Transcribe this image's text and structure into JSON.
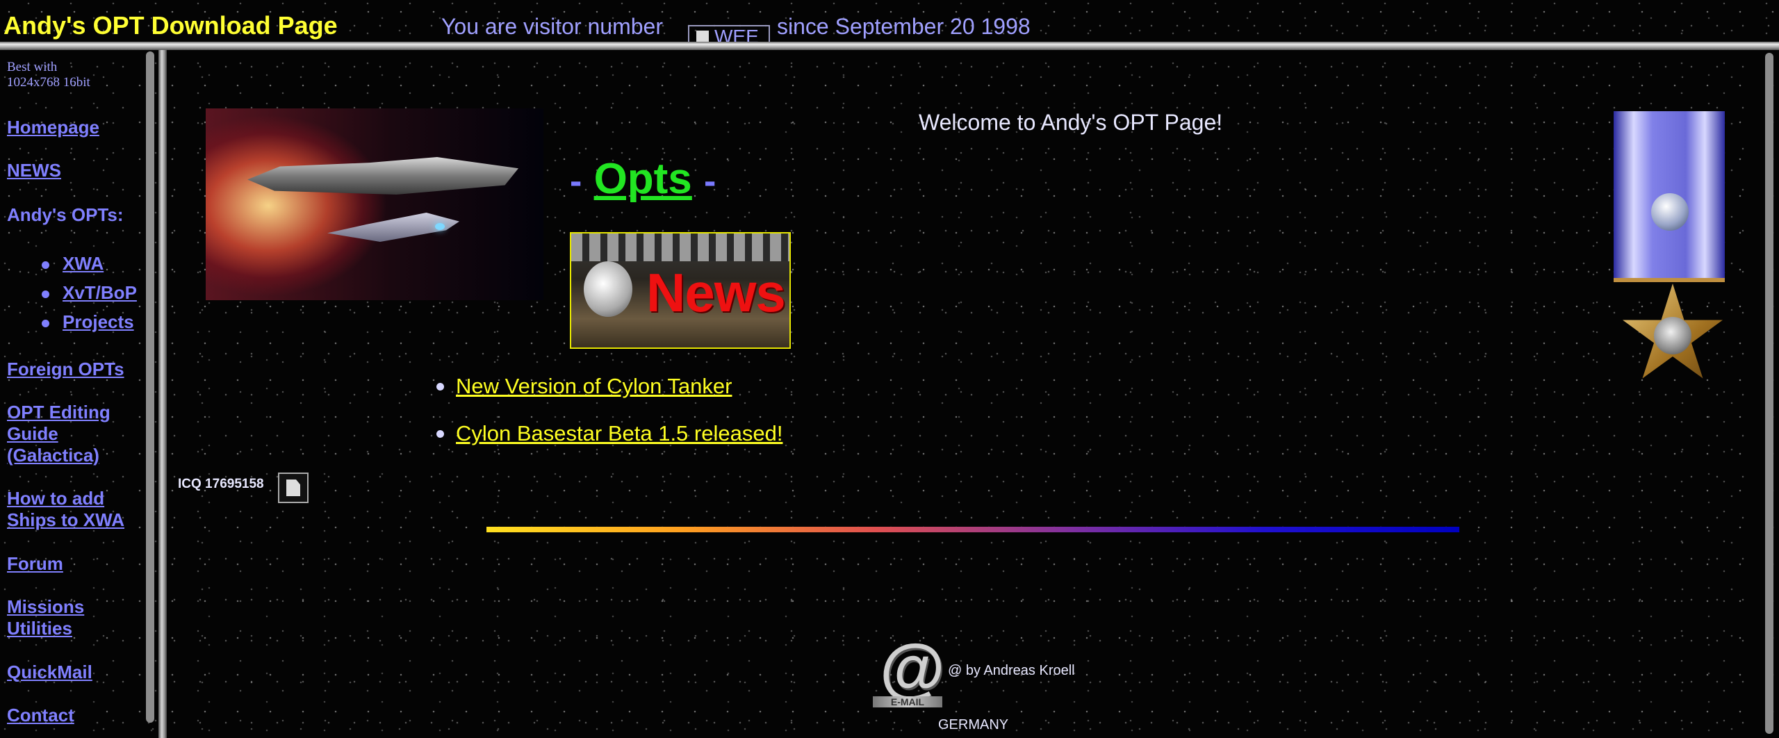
{
  "header": {
    "title": "Andy's OPT Download Page",
    "visitor_prefix": "You are visitor number",
    "counter_text": "WEE",
    "visitor_suffix": "since September 20  1998"
  },
  "sidebar": {
    "note_line1": "Best with",
    "note_line2": "1024x768 16bit",
    "items": [
      {
        "label": "Homepage",
        "link": true
      },
      {
        "label": "NEWS",
        "link": true
      },
      {
        "label": "Andy's OPTs:",
        "link": false
      },
      {
        "label": "Foreign OPTs",
        "link": true
      },
      {
        "label": "OPT Editing Guide (Galactica)",
        "link": true
      },
      {
        "label": "How to add Ships to XWA",
        "link": true
      },
      {
        "label": "Forum",
        "link": true
      },
      {
        "label": "Missions Utilities",
        "link": true
      },
      {
        "label": "QuickMail",
        "link": true
      },
      {
        "label": "Contact",
        "link": true
      }
    ],
    "sub_items": [
      {
        "label": "XWA"
      },
      {
        "label": "XvT/BoP"
      },
      {
        "label": "Projects"
      }
    ]
  },
  "main": {
    "welcome": "Welcome to Andy's OPT Page!",
    "opts_dash_left": "-",
    "opts_link": "Opts",
    "opts_dash_right": "-",
    "news_banner_text": "News",
    "news_items": [
      {
        "label": "New Version of Cylon Tanker"
      },
      {
        "label": "Cylon Basestar Beta 1.5 released!"
      }
    ],
    "icq": "ICQ 17695158",
    "email_ribbon": "E-MAIL",
    "copyright": "@ by Andreas Kroell",
    "country": "GERMANY"
  },
  "colors": {
    "title": "#ffff33",
    "nav_link": "#8080ff",
    "opts_link": "#22e622",
    "news_link": "#ffff22",
    "text": "#e8e8ff"
  }
}
